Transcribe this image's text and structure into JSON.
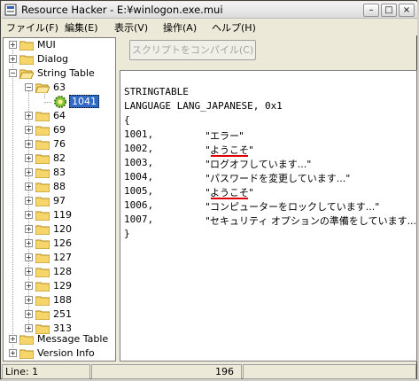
{
  "window": {
    "title": "Resource Hacker  -  E:¥winlogon.exe.mui",
    "minimize_glyph": "–",
    "maximize_glyph": "□",
    "close_glyph": "×"
  },
  "menu": [
    {
      "label": "ファイル(F)"
    },
    {
      "label": "編集(E)"
    },
    {
      "label": "表示(V)"
    },
    {
      "label": "操作(A)"
    },
    {
      "label": "ヘルプ(H)"
    }
  ],
  "tree": {
    "top_items": [
      {
        "label": "MUI"
      },
      {
        "label": "Dialog"
      },
      {
        "label": "String Table"
      }
    ],
    "string_table_children": [
      {
        "label": "63"
      },
      {
        "label": "1041"
      },
      {
        "label": "64"
      },
      {
        "label": "69"
      },
      {
        "label": "76"
      },
      {
        "label": "82"
      },
      {
        "label": "83"
      },
      {
        "label": "88"
      },
      {
        "label": "97"
      },
      {
        "label": "119"
      },
      {
        "label": "120"
      },
      {
        "label": "126"
      },
      {
        "label": "127"
      },
      {
        "label": "128"
      },
      {
        "label": "129"
      },
      {
        "label": "188"
      },
      {
        "label": "251"
      },
      {
        "label": "313"
      }
    ],
    "bottom_items": [
      {
        "label": "Message Table"
      },
      {
        "label": "Version Info"
      }
    ]
  },
  "toolbar": {
    "compile_label": "スクリプトをコンパイル(C)"
  },
  "editor": {
    "header_lines": [
      "STRINGTABLE",
      "LANGUAGE LANG_JAPANESE, 0x1",
      "{"
    ],
    "entries": [
      {
        "id": "1001,",
        "text": "\"エラー\""
      },
      {
        "id": "1002,",
        "text": "\"ようこそ\""
      },
      {
        "id": "1003,",
        "text": "\"ログオフしています...\""
      },
      {
        "id": "1004,",
        "text": "\"パスワードを変更しています...\""
      },
      {
        "id": "1005,",
        "text": "\"ようこそ\""
      },
      {
        "id": "1006,",
        "text": "\"コンピューターをロックしています...\""
      },
      {
        "id": "1007,",
        "text": "\"セキュリティ オプションの準備をしています...\""
      }
    ],
    "closing": "}",
    "highlight_color": "#e0000a"
  },
  "status": {
    "line": "Line: 1",
    "col": "196"
  }
}
